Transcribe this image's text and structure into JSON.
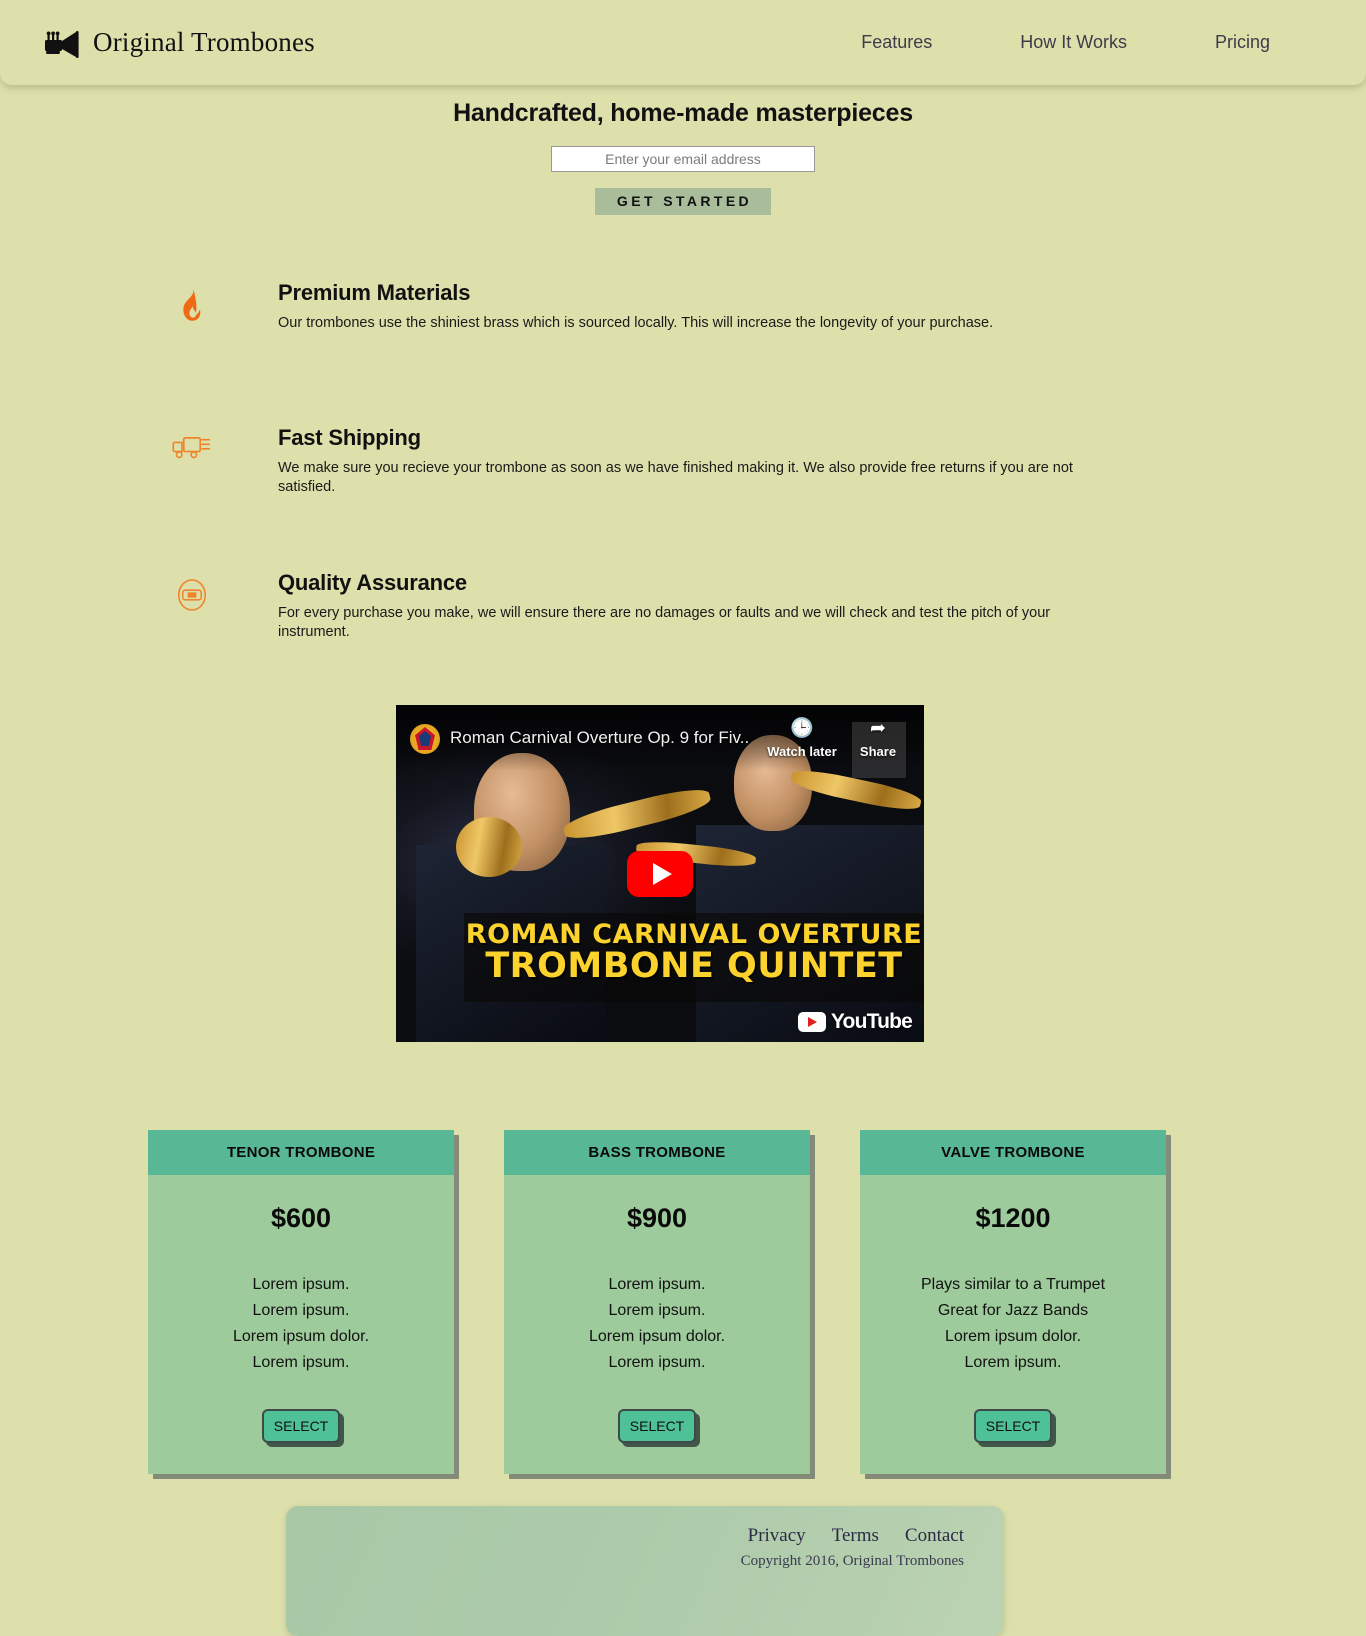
{
  "header": {
    "logo_icon": "trumpet-icon",
    "brand_name": "Original Trombones",
    "nav": [
      {
        "label": "Features"
      },
      {
        "label": "How It Works"
      },
      {
        "label": "Pricing"
      }
    ]
  },
  "hero": {
    "title": "Handcrafted, home-made masterpieces",
    "email_placeholder": "Enter your email address",
    "email_value": "",
    "cta_label": "GET STARTED"
  },
  "features": [
    {
      "icon": "flame-icon",
      "icon_color": "#f06a13",
      "title": "Premium Materials",
      "text": "Our trombones use the shiniest brass which is sourced locally. This will increase the longevity of your purchase."
    },
    {
      "icon": "delivery-truck-icon",
      "icon_color": "#f0842a",
      "title": "Fast Shipping",
      "text": "We make sure you recieve your trombone as soon as we have finished making it. We also provide free returns if you are not satisfied."
    },
    {
      "icon": "quality-badge-icon",
      "icon_color": "#f0842a",
      "title": "Quality Assurance",
      "text": "For every purchase you make, we will ensure there are no damages or faults and we will check and test the pitch of your instrument."
    }
  ],
  "video": {
    "title": "Roman Carnival Overture Op. 9 for Fiv...",
    "watch_later_label": "Watch later",
    "share_label": "Share",
    "thumbnail_line1": "ROMAN CARNIVAL OVERTURE",
    "thumbnail_line2": "TROMBONE QUINTET",
    "watermark": "YouTube",
    "play_button": "play-icon"
  },
  "pricing": {
    "cards": [
      {
        "name": "TENOR TROMBONE",
        "price": "$600",
        "features": [
          "Lorem ipsum.",
          "Lorem ipsum.",
          "Lorem ipsum dolor.",
          "Lorem ipsum."
        ],
        "button_label": "SELECT"
      },
      {
        "name": "BASS TROMBONE",
        "price": "$900",
        "features": [
          "Lorem ipsum.",
          "Lorem ipsum.",
          "Lorem ipsum dolor.",
          "Lorem ipsum."
        ],
        "button_label": "SELECT"
      },
      {
        "name": "VALVE TROMBONE",
        "price": "$1200",
        "features": [
          "Plays similar to a Trumpet",
          "Great for Jazz Bands",
          "Lorem ipsum dolor.",
          "Lorem ipsum."
        ],
        "button_label": "SELECT"
      }
    ]
  },
  "footer": {
    "links": [
      {
        "label": "Privacy"
      },
      {
        "label": "Terms"
      },
      {
        "label": "Contact"
      }
    ],
    "copyright": "Copyright 2016, Original Trombones"
  },
  "colors": {
    "page_background": "#dde0ab",
    "card_body": "#9ecb9b",
    "card_header": "#58b795",
    "cta_button": "#a9bd9b",
    "select_button": "#4ec196",
    "accent_orange": "#f0842a",
    "footer_panel": "#aecbab"
  }
}
